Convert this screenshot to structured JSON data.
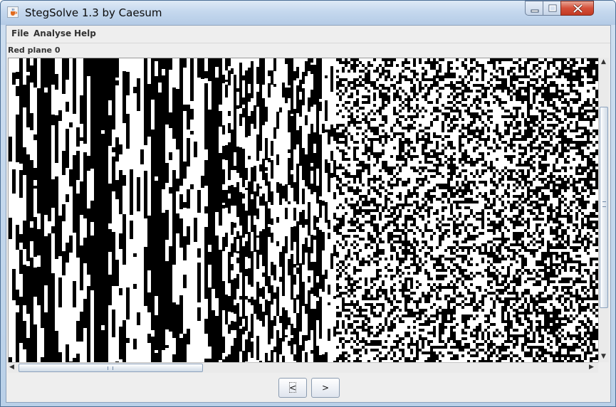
{
  "window": {
    "title": "StegSolve 1.3 by Caesum"
  },
  "menu": {
    "items": [
      {
        "label": "File"
      },
      {
        "label": "Analyse"
      },
      {
        "label": "Help"
      }
    ]
  },
  "viewer": {
    "plane_label": "Red plane 0"
  },
  "navigation": {
    "prev_label": "<",
    "next_label": ">"
  },
  "icons": {
    "app": "java-cup-icon",
    "minimize": "minimize-icon",
    "maximize": "maximize-icon",
    "close": "close-icon"
  },
  "colors": {
    "client_background": "#eeeeee",
    "close_button": "#c23a22",
    "image_foreground": "#000000",
    "image_background": "#ffffff"
  }
}
